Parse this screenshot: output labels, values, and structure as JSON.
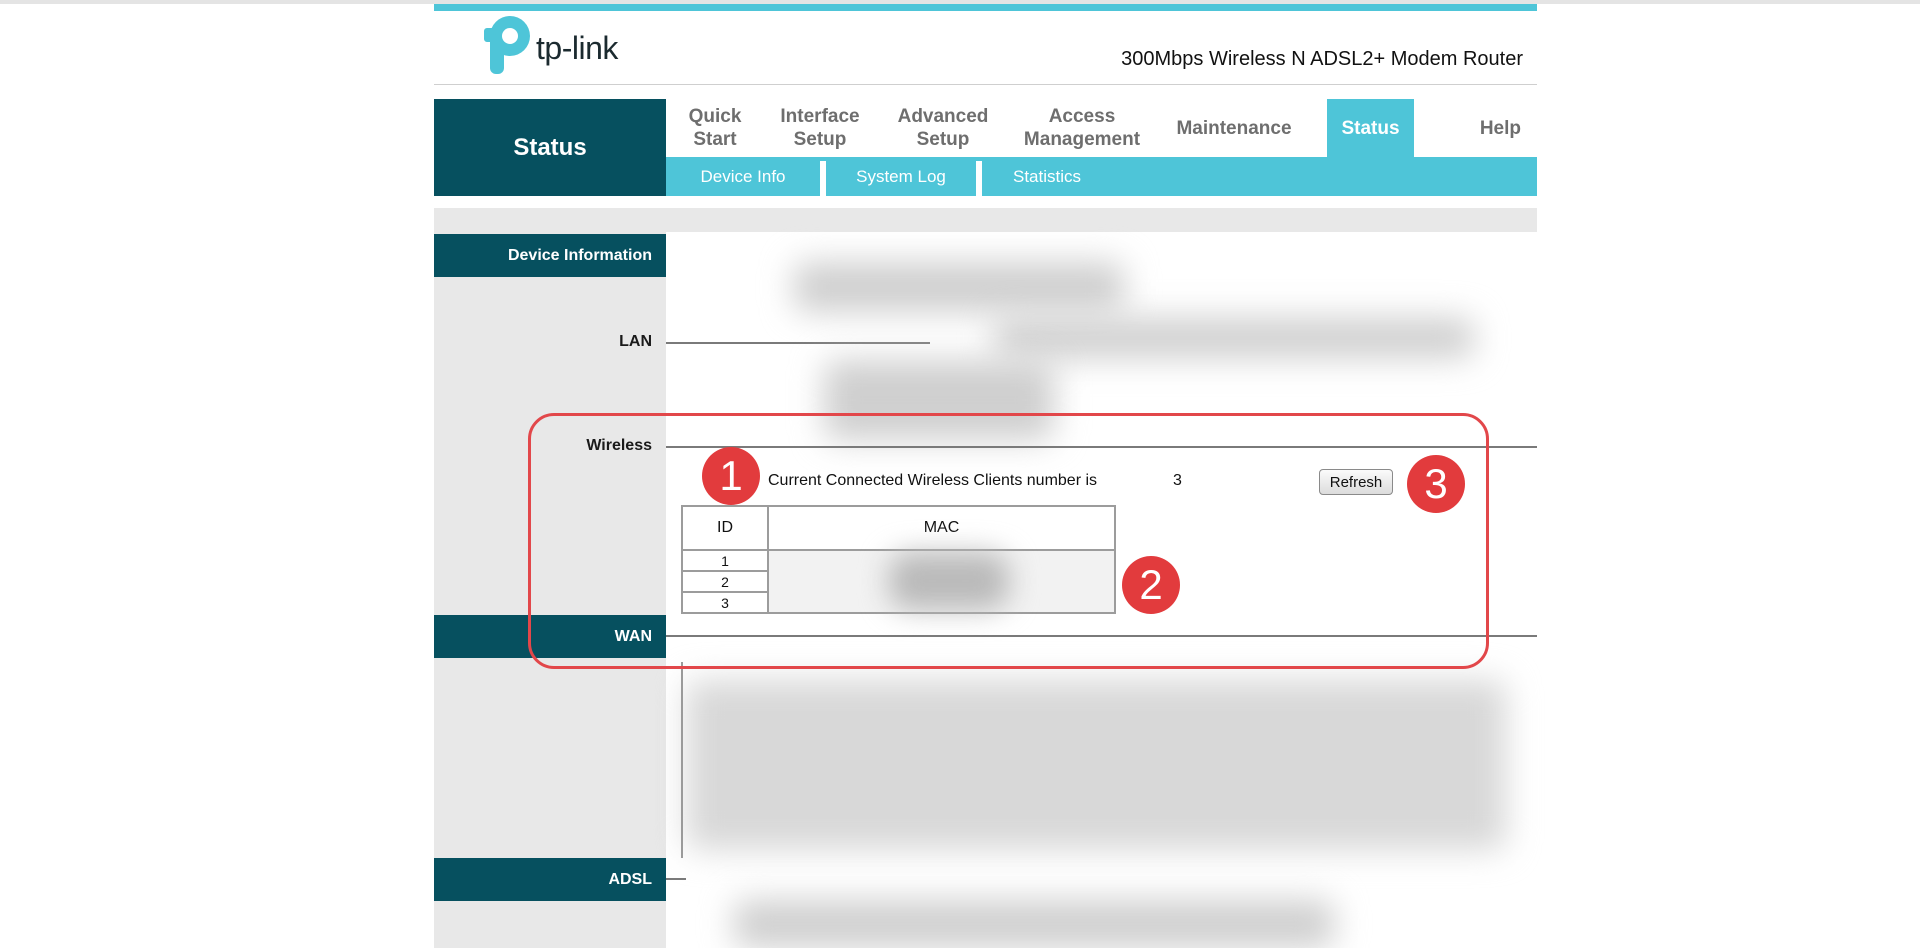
{
  "header": {
    "brand": "tp-link",
    "product_title": "300Mbps Wireless N ADSL2+ Modem Router",
    "accent_color": "#4ec5d8",
    "dark_color": "#06505f"
  },
  "status_box": {
    "label": "Status"
  },
  "nav": {
    "items": [
      {
        "label": "Quick\nStart"
      },
      {
        "label": "Interface\nSetup"
      },
      {
        "label": "Advanced\nSetup"
      },
      {
        "label": "Access\nManagement"
      },
      {
        "label": "Maintenance"
      },
      {
        "label": "Status",
        "active": true
      },
      {
        "label": "Help"
      }
    ]
  },
  "subnav": {
    "items": [
      {
        "label": "Device Info"
      },
      {
        "label": "System Log"
      },
      {
        "label": "Statistics"
      }
    ]
  },
  "sections": {
    "device_info": "Device Information",
    "lan": "LAN",
    "wireless": "Wireless",
    "wan": "WAN",
    "adsl": "ADSL"
  },
  "wireless": {
    "clients_text": "Current Connected Wireless Clients number is",
    "clients_count": "3",
    "refresh_label": "Refresh",
    "table": {
      "headers": [
        "ID",
        "MAC"
      ],
      "rows": [
        {
          "id": "1",
          "mac": ""
        },
        {
          "id": "2",
          "mac": ""
        },
        {
          "id": "3",
          "mac": ""
        }
      ]
    }
  },
  "annotations": {
    "badges": [
      "1",
      "2",
      "3"
    ],
    "highlight_color": "#e2474a"
  }
}
